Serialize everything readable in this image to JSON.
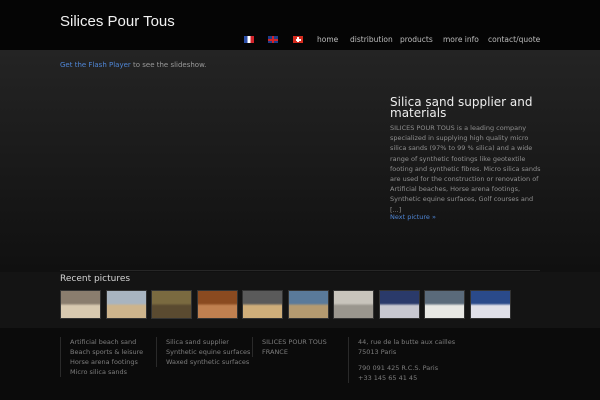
{
  "header": {
    "site_title": "Silices Pour Tous"
  },
  "nav": {
    "languages": [
      {
        "icon": "flag-france-icon",
        "lang": "fr"
      },
      {
        "icon": "flag-uk-icon",
        "lang": "en"
      },
      {
        "icon": "flag-switzerland-icon",
        "lang": "ch"
      }
    ],
    "items": [
      {
        "label": "home"
      },
      {
        "label": "distribution"
      },
      {
        "label": "products"
      },
      {
        "label": "more info"
      },
      {
        "label": "contact/quote"
      }
    ]
  },
  "hero": {
    "flash_link": "Get the Flash Player",
    "flash_text": " to see the slideshow.",
    "slide_title": "Silica sand supplier and materials",
    "slide_text": "SILICES POUR TOUS is a leading company specialized in supplying high quality micro silica sands (97% to 99 % silica) and a wide range of synthetic footings like geotextile footing and synthetic fibres. Micro silica sands are used for the construction or renovation of Artificial beaches, Horse arena footings, Synthetic equine surfaces, Golf courses and [...]",
    "next_link": "Next picture »"
  },
  "recent": {
    "title": "Recent pictures",
    "thumbnails": [
      {
        "colors": [
          "#8a7d6e",
          "#d8c9b0"
        ]
      },
      {
        "colors": [
          "#a8b4c0",
          "#cdb48c"
        ]
      },
      {
        "colors": [
          "#7a6a40",
          "#5a4a30"
        ]
      },
      {
        "colors": [
          "#8a4a20",
          "#c08050"
        ]
      },
      {
        "colors": [
          "#5a5a5a",
          "#cfae7a"
        ]
      },
      {
        "colors": [
          "#5a7a9a",
          "#b49a70"
        ]
      },
      {
        "colors": [
          "#c8c4bc",
          "#9a968e"
        ]
      },
      {
        "colors": [
          "#2a3a6a",
          "#c8c8d0"
        ]
      },
      {
        "colors": [
          "#5a6a7a",
          "#e8e8e4"
        ]
      },
      {
        "colors": [
          "#2a4a8a",
          "#e0e0e8"
        ]
      }
    ]
  },
  "footer": {
    "col1": [
      "Artificial beach sand",
      "Beach sports & leisure",
      "Horse arena footings",
      "Micro silica sands"
    ],
    "col2": [
      "Silica sand supplier",
      "Synthetic equine surfaces",
      "Waxed synthetic surfaces"
    ],
    "col3": [
      "SILICES POUR TOUS",
      "FRANCE"
    ],
    "col4a": [
      "44, rue de la butte aux cailles",
      "75013 Paris"
    ],
    "col4b": [
      "790 091 425 R.C.S. Paris",
      "+33 145 65 41 45"
    ]
  }
}
